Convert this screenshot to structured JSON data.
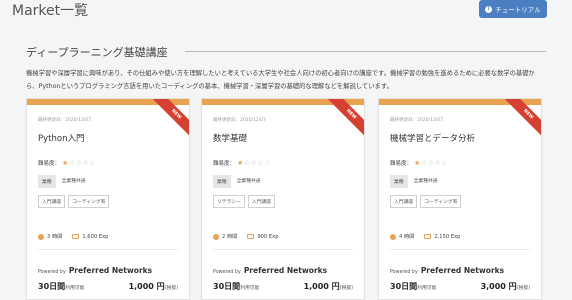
{
  "header": {
    "title": "Market一覧",
    "tutorial_label": "チュートリアル"
  },
  "section": {
    "title": "ディープラーニング基礎講座",
    "description_line1": "機械学習や深層学習に興味があり、その仕組みや使い方を理解したいと考えている大学生や社会人向けの初心者向けの講座です。機械学習の勉強を進めるために必要な数学の基礎か",
    "description_line2": "ら、Pythonというプログラミング言語を用いたコーディングの基本、機械学習・深層学習の基礎的な理解などを解説しています。"
  },
  "labels": {
    "difficulty": "難易度：",
    "powered_by": "Powered by",
    "available": "利用可能",
    "tax": "(税抜)",
    "ribbon": "NEW"
  },
  "colors": {
    "accent": "#e9a250",
    "ribbon": "#d64032",
    "button": "#4a7fc1"
  },
  "cards": [
    {
      "updated": "最終更新日：2020/12/07",
      "title": "Python入門",
      "difficulty_stars": 1,
      "stars_filled": "★",
      "stars_empty": "☆☆☆☆",
      "category": "業種",
      "category_value": "全業種共通",
      "tags": [
        "入門講座",
        "コーディング有"
      ],
      "hours": "3 時間",
      "exp": "1,600 Exp",
      "provider": "Preferred Networks",
      "days": "30日間",
      "price": "1,000 円"
    },
    {
      "updated": "最終更新日：2020/12/07",
      "title": "数学基礎",
      "difficulty_stars": 1,
      "stars_filled": "★",
      "stars_empty": "☆☆☆☆",
      "category": "業種",
      "category_value": "全業種共通",
      "tags": [
        "リテラシー",
        "入門講座"
      ],
      "hours": "2 時間",
      "exp": "900 Exp",
      "provider": "Preferred Networks",
      "days": "30日間",
      "price": "1,000 円"
    },
    {
      "updated": "最終更新日：2020/12/07",
      "title": "機械学習とデータ分析",
      "difficulty_stars": 1,
      "stars_filled": "★",
      "stars_empty": "☆☆☆☆",
      "category": "業種",
      "category_value": "全業種共通",
      "tags": [
        "入門講座",
        "コーディング有"
      ],
      "hours": "4 時間",
      "exp": "2,150 Exp",
      "provider": "Preferred Networks",
      "days": "30日間",
      "price": "3,000 円"
    }
  ]
}
